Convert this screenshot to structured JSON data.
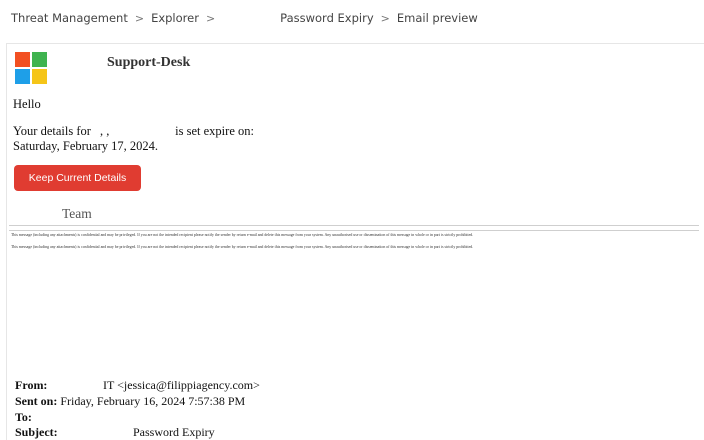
{
  "breadcrumb": {
    "items": [
      "Threat Management",
      "Explorer",
      "Password Expiry",
      "Email preview"
    ],
    "separator": ">"
  },
  "email": {
    "sender_display": "Support-Desk",
    "logo_icon": "windows-logo-icon",
    "logo_colors": [
      "#f25022",
      "#3fb34f",
      "#1e9fe8",
      "#f5c518"
    ],
    "greeting": "Hello",
    "details_prefix": "Your details for",
    "details_redacted": ", ,",
    "details_suffix": "is set expire on:",
    "expiry_date": "Saturday, February 17, 2024.",
    "button_label": "Keep Current Details",
    "button_color": "#e03c31",
    "signature": "Team",
    "disclaimer": "This message (including any attachments) is confidential and may be privileged. If you are not the intended recipient please notify the sender by return e-mail and delete this message from your system. Any unauthorised use or dissemination of this message in whole or in part is strictly prohibited.",
    "headers": {
      "from_label": "From:",
      "from_value": "IT <jessica@filippiagency.com>",
      "sent_label": "Sent on:",
      "sent_value": "Friday, February 16, 2024 7:57:38 PM",
      "to_label": "To:",
      "to_value": "",
      "subject_label": "Subject:",
      "subject_value": "Password Expiry"
    }
  }
}
